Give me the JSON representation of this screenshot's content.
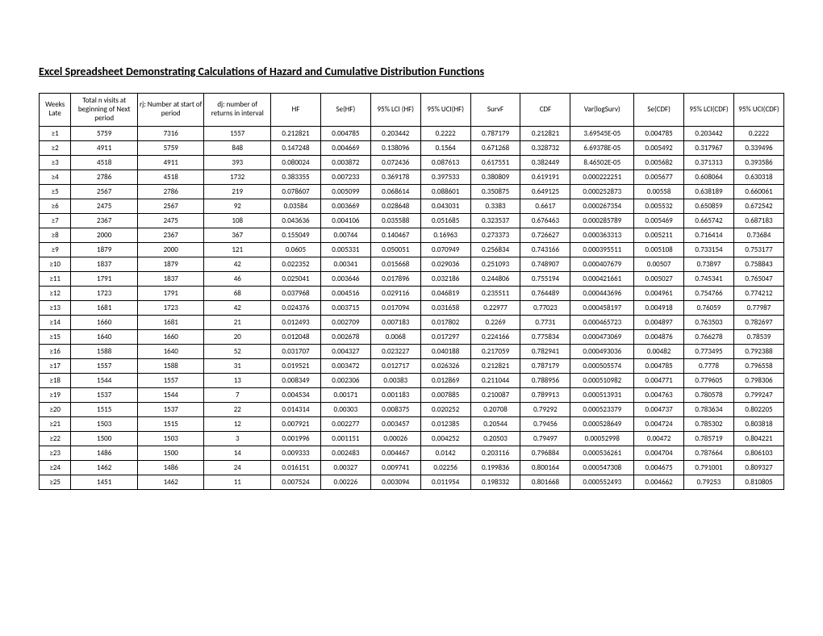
{
  "title": "Excel Spreadsheet Demonstrating Calculations of Hazard and Cumulative Distribution Functions",
  "headers": [
    "Weeks Late",
    "Total n visits at beginning of Next period",
    "rj: Number at start of period",
    "dj: number of returns in interval",
    "HF",
    "Se(HF)",
    "95% LCI (HF)",
    "95% UCI(HF)",
    "SurvF",
    "CDF",
    "Var(logSurv)",
    "Se(CDF)",
    "95% LCI(CDF)",
    "95% UCI(CDF)"
  ],
  "rows": [
    [
      "≥1",
      "5759",
      "7316",
      "1557",
      "0.212821",
      "0.004785",
      "0.203442",
      "0.2222",
      "0.787179",
      "0.212821",
      "3.69545E-05",
      "0.004785",
      "0.203442",
      "0.2222"
    ],
    [
      "≥2",
      "4911",
      "5759",
      "848",
      "0.147248",
      "0.004669",
      "0.138096",
      "0.1564",
      "0.671268",
      "0.328732",
      "6.69378E-05",
      "0.005492",
      "0.317967",
      "0.339496"
    ],
    [
      "≥3",
      "4518",
      "4911",
      "393",
      "0.080024",
      "0.003872",
      "0.072436",
      "0.087613",
      "0.617551",
      "0.382449",
      "8.46502E-05",
      "0.005682",
      "0.371313",
      "0.393586"
    ],
    [
      "≥4",
      "2786",
      "4518",
      "1732",
      "0.383355",
      "0.007233",
      "0.369178",
      "0.397533",
      "0.380809",
      "0.619191",
      "0.000222251",
      "0.005677",
      "0.608064",
      "0.630318"
    ],
    [
      "≥5",
      "2567",
      "2786",
      "219",
      "0.078607",
      "0.005099",
      "0.068614",
      "0.088601",
      "0.350875",
      "0.649125",
      "0.000252873",
      "0.00558",
      "0.638189",
      "0.660061"
    ],
    [
      "≥6",
      "2475",
      "2567",
      "92",
      "0.03584",
      "0.003669",
      "0.028648",
      "0.043031",
      "0.3383",
      "0.6617",
      "0.000267354",
      "0.005532",
      "0.650859",
      "0.672542"
    ],
    [
      "≥7",
      "2367",
      "2475",
      "108",
      "0.043636",
      "0.004106",
      "0.035588",
      "0.051685",
      "0.323537",
      "0.676463",
      "0.000285789",
      "0.005469",
      "0.665742",
      "0.687183"
    ],
    [
      "≥8",
      "2000",
      "2367",
      "367",
      "0.155049",
      "0.00744",
      "0.140467",
      "0.16963",
      "0.273373",
      "0.726627",
      "0.000363313",
      "0.005211",
      "0.716414",
      "0.73684"
    ],
    [
      "≥9",
      "1879",
      "2000",
      "121",
      "0.0605",
      "0.005331",
      "0.050051",
      "0.070949",
      "0.256834",
      "0.743166",
      "0.000395511",
      "0.005108",
      "0.733154",
      "0.753177"
    ],
    [
      "≥10",
      "1837",
      "1879",
      "42",
      "0.022352",
      "0.00341",
      "0.015668",
      "0.029036",
      "0.251093",
      "0.748907",
      "0.000407679",
      "0.00507",
      "0.73897",
      "0.758843"
    ],
    [
      "≥11",
      "1791",
      "1837",
      "46",
      "0.025041",
      "0.003646",
      "0.017896",
      "0.032186",
      "0.244806",
      "0.755194",
      "0.000421661",
      "0.005027",
      "0.745341",
      "0.765047"
    ],
    [
      "≥12",
      "1723",
      "1791",
      "68",
      "0.037968",
      "0.004516",
      "0.029116",
      "0.046819",
      "0.235511",
      "0.764489",
      "0.000443696",
      "0.004961",
      "0.754766",
      "0.774212"
    ],
    [
      "≥13",
      "1681",
      "1723",
      "42",
      "0.024376",
      "0.003715",
      "0.017094",
      "0.031658",
      "0.22977",
      "0.77023",
      "0.000458197",
      "0.004918",
      "0.76059",
      "0.77987"
    ],
    [
      "≥14",
      "1660",
      "1681",
      "21",
      "0.012493",
      "0.002709",
      "0.007183",
      "0.017802",
      "0.2269",
      "0.7731",
      "0.000465723",
      "0.004897",
      "0.763503",
      "0.782697"
    ],
    [
      "≥15",
      "1640",
      "1660",
      "20",
      "0.012048",
      "0.002678",
      "0.0068",
      "0.017297",
      "0.224166",
      "0.775834",
      "0.000473069",
      "0.004876",
      "0.766278",
      "0.78539"
    ],
    [
      "≥16",
      "1588",
      "1640",
      "52",
      "0.031707",
      "0.004327",
      "0.023227",
      "0.040188",
      "0.217059",
      "0.782941",
      "0.000493036",
      "0.00482",
      "0.773495",
      "0.792388"
    ],
    [
      "≥17",
      "1557",
      "1588",
      "31",
      "0.019521",
      "0.003472",
      "0.012717",
      "0.026326",
      "0.212821",
      "0.787179",
      "0.000505574",
      "0.004785",
      "0.7778",
      "0.796558"
    ],
    [
      "≥18",
      "1544",
      "1557",
      "13",
      "0.008349",
      "0.002306",
      "0.00383",
      "0.012869",
      "0.211044",
      "0.788956",
      "0.000510982",
      "0.004771",
      "0.779605",
      "0.798306"
    ],
    [
      "≥19",
      "1537",
      "1544",
      "7",
      "0.004534",
      "0.00171",
      "0.001183",
      "0.007885",
      "0.210087",
      "0.789913",
      "0.000513931",
      "0.004763",
      "0.780578",
      "0.799247"
    ],
    [
      "≥20",
      "1515",
      "1537",
      "22",
      "0.014314",
      "0.00303",
      "0.008375",
      "0.020252",
      "0.20708",
      "0.79292",
      "0.000523379",
      "0.004737",
      "0.783634",
      "0.802205"
    ],
    [
      "≥21",
      "1503",
      "1515",
      "12",
      "0.007921",
      "0.002277",
      "0.003457",
      "0.012385",
      "0.20544",
      "0.79456",
      "0.000528649",
      "0.004724",
      "0.785302",
      "0.803818"
    ],
    [
      "≥22",
      "1500",
      "1503",
      "3",
      "0.001996",
      "0.001151",
      "0.00026",
      "0.004252",
      "0.20503",
      "0.79497",
      "0.00052998",
      "0.00472",
      "0.785719",
      "0.804221"
    ],
    [
      "≥23",
      "1486",
      "1500",
      "14",
      "0.009333",
      "0.002483",
      "0.004467",
      "0.0142",
      "0.203116",
      "0.796884",
      "0.000536261",
      "0.004704",
      "0.787664",
      "0.806103"
    ],
    [
      "≥24",
      "1462",
      "1486",
      "24",
      "0.016151",
      "0.00327",
      "0.009741",
      "0.02256",
      "0.199836",
      "0.800164",
      "0.000547308",
      "0.004675",
      "0.791001",
      "0.809327"
    ],
    [
      "≥25",
      "1451",
      "1462",
      "11",
      "0.007524",
      "0.00226",
      "0.003094",
      "0.011954",
      "0.198332",
      "0.801668",
      "0.000552493",
      "0.004662",
      "0.79253",
      "0.810805"
    ]
  ]
}
